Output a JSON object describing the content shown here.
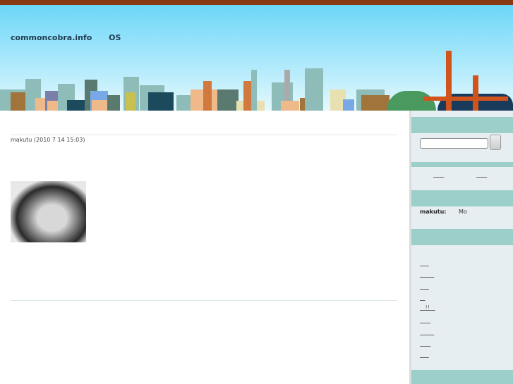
{
  "header": {
    "site_title": "commoncobra.info OS"
  },
  "post": {
    "meta": "makutu (2010 7 14  15:03)"
  },
  "sidebar": {
    "nav_links": [
      "      ",
      "      "
    ],
    "comment_user": "makutu:",
    "comment_text": "Mo    ",
    "links": [
      "     ",
      "        ",
      "     ",
      "   ",
      "   !!   ",
      "      ",
      "        ",
      "      ",
      "     "
    ]
  }
}
